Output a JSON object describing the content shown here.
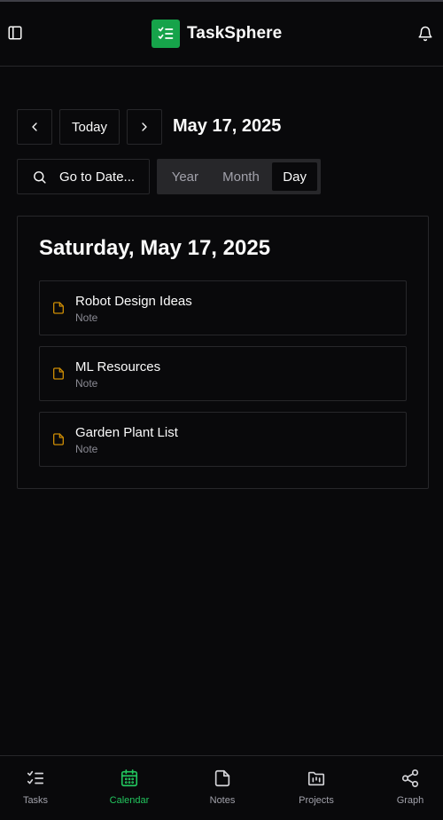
{
  "app": {
    "title": "TaskSphere"
  },
  "toolbar": {
    "today_label": "Today",
    "current_date": "May 17, 2025",
    "goto_label": "Go to Date...",
    "views": [
      "Year",
      "Month",
      "Day"
    ],
    "active_view": "Day"
  },
  "day": {
    "heading": "Saturday, May 17, 2025",
    "items": [
      {
        "title": "Robot Design Ideas",
        "type": "Note"
      },
      {
        "title": "ML Resources",
        "type": "Note"
      },
      {
        "title": "Garden Plant List",
        "type": "Note"
      }
    ]
  },
  "nav": {
    "items": [
      {
        "label": "Tasks",
        "icon": "tasks-icon"
      },
      {
        "label": "Calendar",
        "icon": "calendar-icon"
      },
      {
        "label": "Notes",
        "icon": "notes-icon"
      },
      {
        "label": "Projects",
        "icon": "projects-icon"
      },
      {
        "label": "Graph",
        "icon": "graph-icon"
      }
    ],
    "active": "Calendar"
  },
  "colors": {
    "accent": "#16a34a",
    "active_nav": "#22c55e",
    "note_icon": "#ca8a04",
    "background": "#09090b",
    "border": "#27272a"
  }
}
